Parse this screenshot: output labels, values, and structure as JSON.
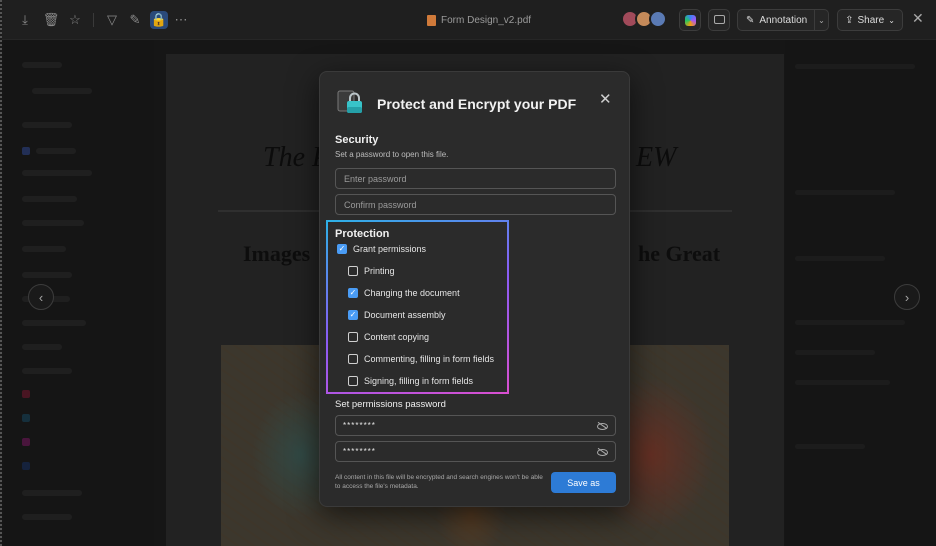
{
  "toolbar": {
    "left_icons": [
      "download-icon",
      "delete-icon",
      "star-icon",
      "filter-icon",
      "draw-icon",
      "protect-icon",
      "more-icon"
    ],
    "file_name": "Form Design_v2.pdf",
    "annotation_label": "Annotation",
    "share_label": "Share",
    "colors": {
      "accent": "#2d7bd6"
    }
  },
  "document": {
    "masthead_left": "The P",
    "masthead_right": "EW",
    "heading_left": "Images",
    "heading_right": "he Great"
  },
  "dialog": {
    "title": "Protect and Encrypt your PDF",
    "security": {
      "heading": "Security",
      "subtitle": "Set a password to open this file.",
      "password_placeholder": "Enter password",
      "confirm_placeholder": "Confirm password"
    },
    "protection": {
      "heading": "Protection",
      "grant_label": "Grant permissions",
      "grant_checked": true,
      "permissions": [
        {
          "label": "Printing",
          "checked": false
        },
        {
          "label": "Changing the document",
          "checked": true
        },
        {
          "label": "Document assembly",
          "checked": true
        },
        {
          "label": "Content copying",
          "checked": false
        },
        {
          "label": "Commenting, filling in form fields",
          "checked": false
        },
        {
          "label": "Signing, filling in form fields",
          "checked": false
        }
      ]
    },
    "permissions_password": {
      "heading": "Set permissions password",
      "password_value": "********",
      "confirm_value": "********"
    },
    "footer_note": "All content in this file will be encrypted and search engines won't be able to access the file's metadata.",
    "save_label": "Save as"
  }
}
